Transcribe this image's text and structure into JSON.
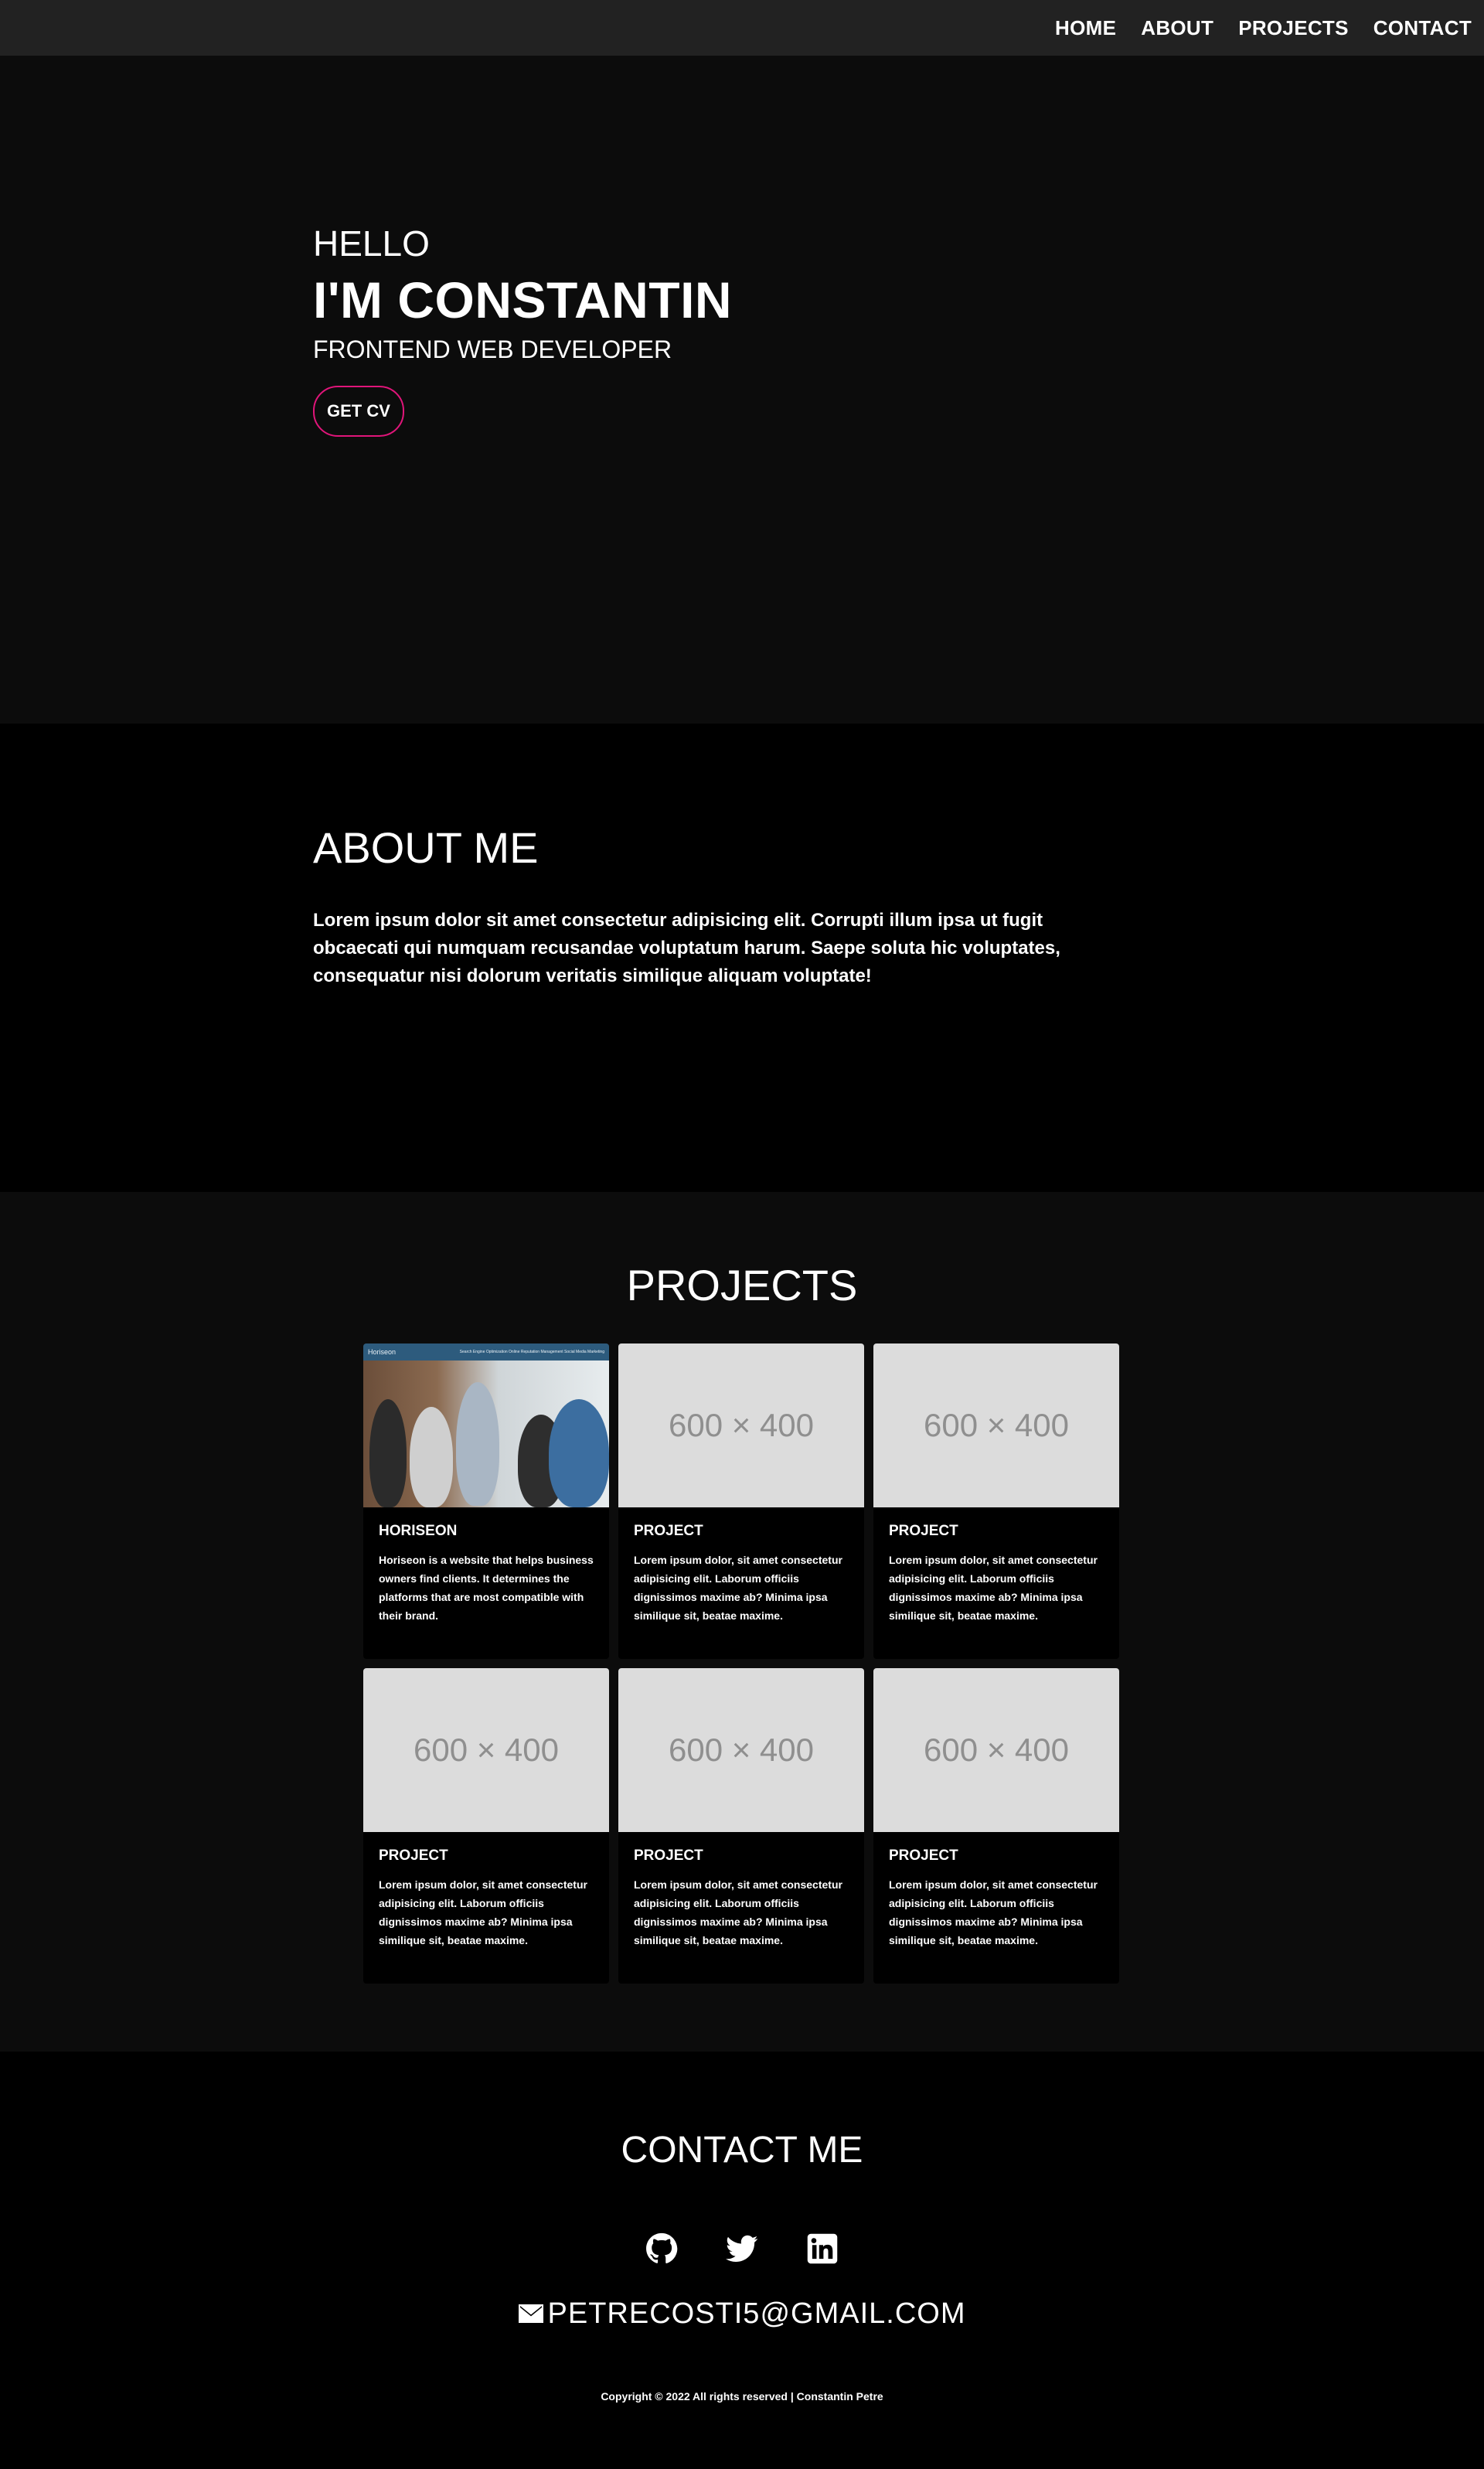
{
  "nav": {
    "items": [
      "HOME",
      "ABOUT",
      "PROJECTS",
      "CONTACT"
    ]
  },
  "hero": {
    "greeting": "HELLO",
    "name": "I'M CONSTANTIN",
    "role": "FRONTEND WEB DEVELOPER",
    "cv_button": "GET CV",
    "accent_color": "#e0157a"
  },
  "about": {
    "title": "ABOUT ME",
    "text": "Lorem ipsum dolor sit amet consectetur adipisicing elit. Corrupti illum ipsa ut fugit obcaecati qui numquam recusandae voluptatum harum. Saepe soluta hic voluptates, consequatur nisi dolorum veritatis similique aliquam voluptate!"
  },
  "projects": {
    "title": "PROJECTS",
    "placeholder": "600 × 400",
    "screenshot_bar": {
      "brand": "Horiseon",
      "links": "Search Engine Optimization   Online Reputation Management   Social Media Marketing"
    },
    "cards": [
      {
        "title": "HORISEON",
        "text": "Horiseon is a website that helps business owners find clients. It determines the platforms that are most compatible with their brand."
      },
      {
        "title": "PROJECT",
        "text": "Lorem ipsum dolor, sit amet consectetur adipisicing elit. Laborum officiis dignissimos maxime ab? Minima ipsa similique sit, beatae maxime."
      },
      {
        "title": "PROJECT",
        "text": "Lorem ipsum dolor, sit amet consectetur adipisicing elit. Laborum officiis dignissimos maxime ab? Minima ipsa similique sit, beatae maxime."
      },
      {
        "title": "PROJECT",
        "text": "Lorem ipsum dolor, sit amet consectetur adipisicing elit. Laborum officiis dignissimos maxime ab? Minima ipsa similique sit, beatae maxime."
      },
      {
        "title": "PROJECT",
        "text": "Lorem ipsum dolor, sit amet consectetur adipisicing elit. Laborum officiis dignissimos maxime ab? Minima ipsa similique sit, beatae maxime."
      },
      {
        "title": "PROJECT",
        "text": "Lorem ipsum dolor, sit amet consectetur adipisicing elit. Laborum officiis dignissimos maxime ab? Minima ipsa similique sit, beatae maxime."
      }
    ]
  },
  "contact": {
    "title": "CONTACT ME",
    "icons": [
      "github-icon",
      "twitter-icon",
      "linkedin-icon"
    ],
    "email": "PETRECOSTI5@GMAIL.COM",
    "copyright": "Copyright © 2022 All rights reserved | Constantin Petre"
  }
}
